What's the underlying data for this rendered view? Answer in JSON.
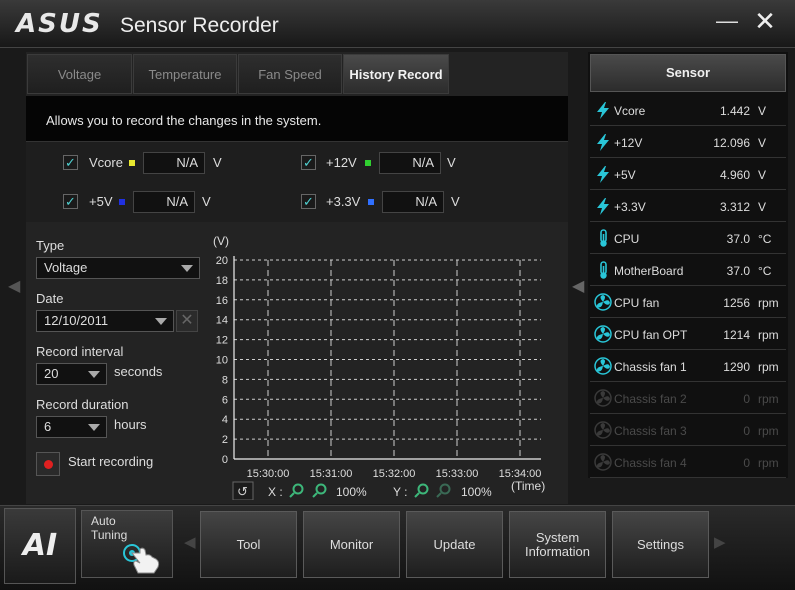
{
  "app": {
    "logo": "ASUS",
    "title": "Sensor Recorder",
    "minimize_icon": "minus",
    "close_icon": "x"
  },
  "tabs": [
    {
      "label": "Voltage",
      "active": false
    },
    {
      "label": "Temperature",
      "active": false
    },
    {
      "label": "Fan Speed",
      "active": false
    },
    {
      "label": "History Record",
      "active": true
    }
  ],
  "description": "Allows you to record the changes in the system.",
  "voltage_items": [
    {
      "label": "Vcore",
      "color": "#e8e830",
      "value": "N/A",
      "unit": "V",
      "checked": true
    },
    {
      "label": "+12V",
      "color": "#30d030",
      "value": "N/A",
      "unit": "V",
      "checked": true
    },
    {
      "label": "+5V",
      "color": "#2030e0",
      "value": "N/A",
      "unit": "V",
      "checked": true
    },
    {
      "label": "+3.3V",
      "color": "#3070ff",
      "value": "N/A",
      "unit": "V",
      "checked": true
    }
  ],
  "controls": {
    "type_label": "Type",
    "type_value": "Voltage",
    "date_label": "Date",
    "date_value": "12/10/2011",
    "interval_label": "Record interval",
    "interval_value": "20",
    "interval_unit": "seconds",
    "duration_label": "Record duration",
    "duration_value": "6",
    "duration_unit": "hours",
    "start_label": "Start recording"
  },
  "chart_data": {
    "type": "line",
    "ylabel": "(V)",
    "xlabel": "(Time)",
    "ylim": [
      0,
      20
    ],
    "yticks": [
      "0",
      "2",
      "4",
      "6",
      "8",
      "10",
      "12",
      "14",
      "16",
      "18",
      "20"
    ],
    "xticks": [
      "15:30:00",
      "15:31:00",
      "15:32:00",
      "15:33:00",
      "15:34:00"
    ],
    "grid": true,
    "series": [],
    "zoom": {
      "x_label": "X :",
      "x_zoom": "100%",
      "y_label": "Y :",
      "y_zoom": "100%"
    }
  },
  "sensor": {
    "header": "Sensor",
    "rows": [
      {
        "icon": "voltage-icon",
        "name": "Vcore",
        "value": "1.442",
        "unit": "V",
        "enabled": true
      },
      {
        "icon": "voltage-icon",
        "name": "+12V",
        "value": "12.096",
        "unit": "V",
        "enabled": true
      },
      {
        "icon": "voltage-icon",
        "name": "+5V",
        "value": "4.960",
        "unit": "V",
        "enabled": true
      },
      {
        "icon": "voltage-icon",
        "name": "+3.3V",
        "value": "3.312",
        "unit": "V",
        "enabled": true
      },
      {
        "icon": "thermometer-icon",
        "name": "CPU",
        "value": "37.0",
        "unit": "°C",
        "enabled": true
      },
      {
        "icon": "thermometer-icon",
        "name": "MotherBoard",
        "value": "37.0",
        "unit": "°C",
        "enabled": true
      },
      {
        "icon": "fan-icon",
        "name": "CPU fan",
        "value": "1256",
        "unit": "rpm",
        "enabled": true
      },
      {
        "icon": "fan-icon",
        "name": "CPU fan OPT",
        "value": "1214",
        "unit": "rpm",
        "enabled": true
      },
      {
        "icon": "fan-icon",
        "name": "Chassis fan 1",
        "value": "1290",
        "unit": "rpm",
        "enabled": true
      },
      {
        "icon": "fan-icon",
        "name": "Chassis fan 2",
        "value": "0",
        "unit": "rpm",
        "enabled": false
      },
      {
        "icon": "fan-icon",
        "name": "Chassis fan 3",
        "value": "0",
        "unit": "rpm",
        "enabled": false
      },
      {
        "icon": "fan-icon",
        "name": "Chassis fan 4",
        "value": "0",
        "unit": "rpm",
        "enabled": false
      }
    ]
  },
  "bottom": {
    "logo": "AI",
    "auto_tuning": "Auto Tuning",
    "menu": [
      {
        "label": "Tool"
      },
      {
        "label": "Monitor"
      },
      {
        "label": "Update"
      },
      {
        "label": "System Information"
      },
      {
        "label": "Settings"
      }
    ]
  }
}
